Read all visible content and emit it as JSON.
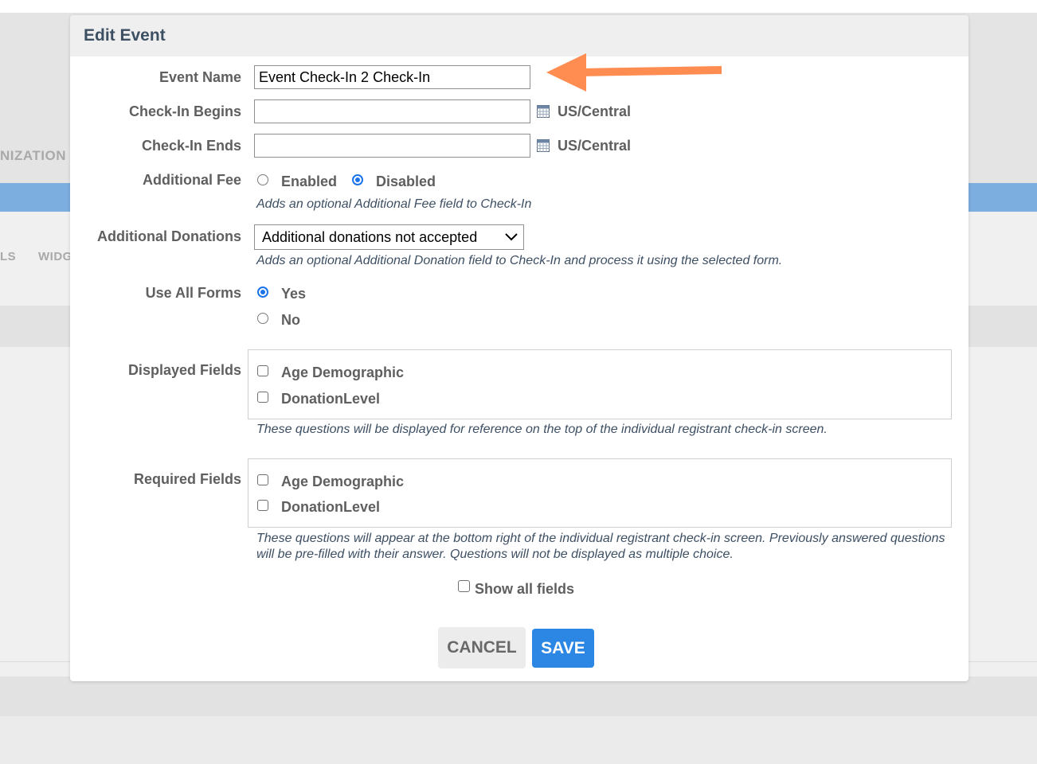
{
  "background": {
    "fragment_left_1": "NIZATION",
    "fragment_left_2": "LS",
    "fragment_left_3": "WIDG"
  },
  "modal": {
    "title": "Edit Event",
    "event_name": {
      "label": "Event Name",
      "value": "Event Check-In 2 Check-In"
    },
    "checkin_begins": {
      "label": "Check-In Begins",
      "value": "",
      "timezone": "US/Central"
    },
    "checkin_ends": {
      "label": "Check-In Ends",
      "value": "",
      "timezone": "US/Central"
    },
    "additional_fee": {
      "label": "Additional Fee",
      "options": [
        "Enabled",
        "Disabled"
      ],
      "selected": "Disabled",
      "help": "Adds an optional Additional Fee field to Check-In"
    },
    "additional_donations": {
      "label": "Additional Donations",
      "selected": "Additional donations not accepted",
      "help": "Adds an optional Additional Donation field to Check-In and process it using the selected form."
    },
    "use_all_forms": {
      "label": "Use All Forms",
      "options": [
        "Yes",
        "No"
      ],
      "selected": "Yes"
    },
    "displayed_fields": {
      "label": "Displayed Fields",
      "items": [
        "Age Demographic",
        "DonationLevel"
      ],
      "help": "These questions will be displayed for reference on the top of the individual registrant check-in screen."
    },
    "required_fields": {
      "label": "Required Fields",
      "items": [
        "Age Demographic",
        "DonationLevel"
      ],
      "help": "These questions will appear at the bottom right of the individual registrant check-in screen. Previously answered questions will be pre-filled with their answer. Questions will not be displayed as multiple choice."
    },
    "show_all_fields": "Show all fields",
    "buttons": {
      "cancel": "CANCEL",
      "save": "SAVE"
    }
  },
  "colors": {
    "annotation_arrow": "#ff8c50",
    "save_button": "#2b87e3",
    "radio_selected": "#1a73e8",
    "background_accent_bar": "#7daee0"
  },
  "icons": {
    "calendar": "calendar-icon",
    "dropdown": "chevron-down-icon",
    "annotation": "arrow-left-icon"
  }
}
